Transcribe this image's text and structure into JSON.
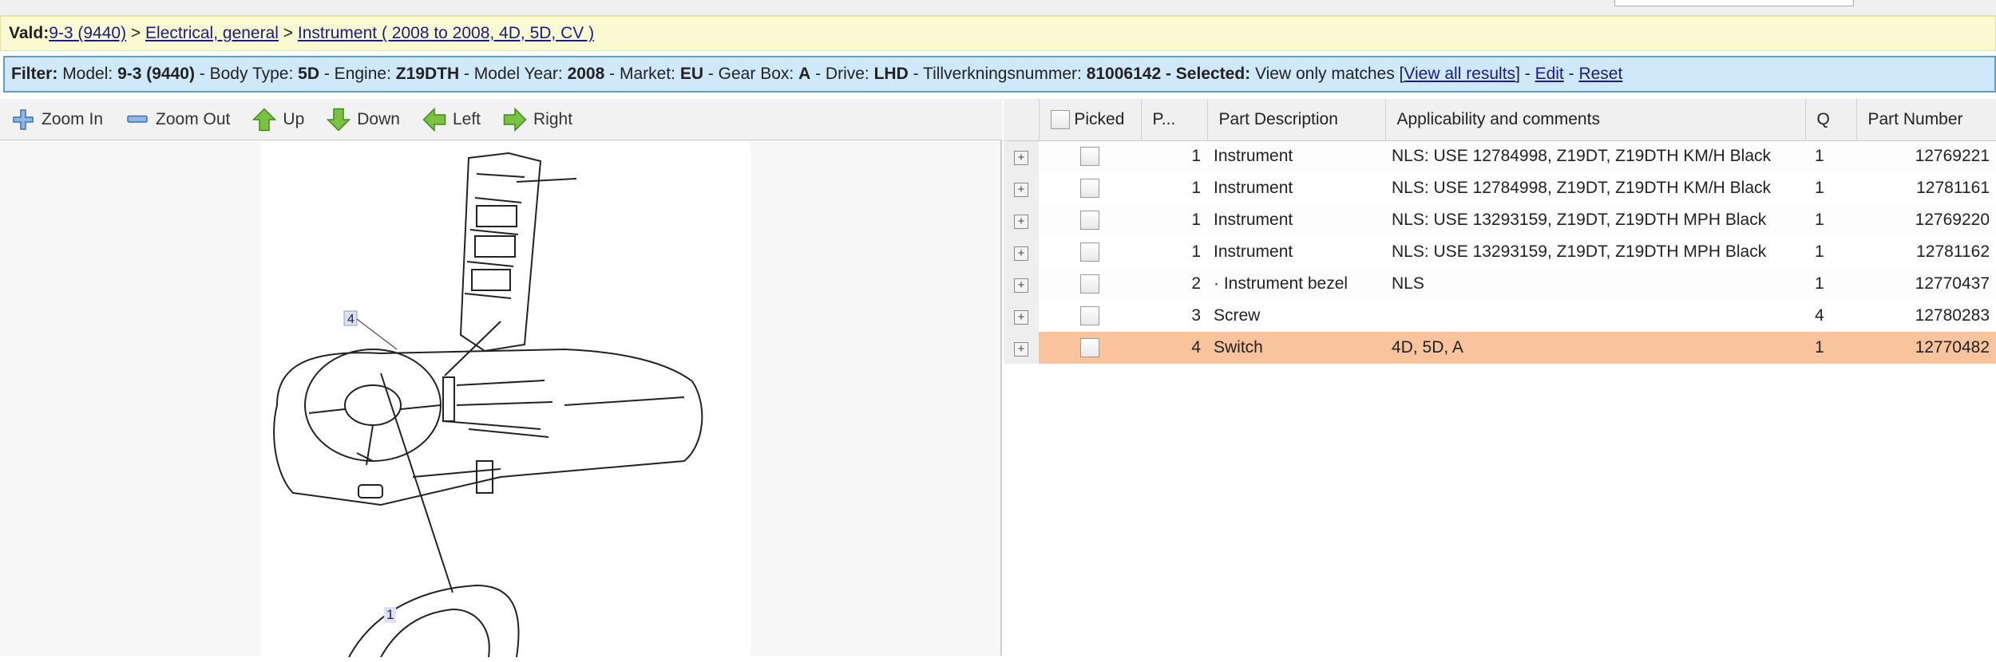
{
  "breadcrumb": {
    "prefix": "Vald:",
    "model": "9-3 (9440)",
    "sep": ">",
    "group": "Electrical, general",
    "item": "Instrument ( 2008 to 2008, 4D, 5D, CV )"
  },
  "filter": {
    "label": "Filter:",
    "model_l": "Model:",
    "model": "9-3 (9440)",
    "body_l": "- Body Type:",
    "body": "5D",
    "engine_l": "- Engine:",
    "engine": "Z19DTH",
    "year_l": "- Model Year:",
    "year": "2008",
    "market_l": "- Market:",
    "market": "EU",
    "gear_l": "- Gear Box:",
    "gear": "A",
    "drive_l": "- Drive:",
    "drive": "LHD",
    "tillv_l": "- Tillverkningsnummer:",
    "tillv": "81006142",
    "selected_l": "- Selected:",
    "selected": "View only matches [",
    "view_all": "View all results",
    "sep1": "] -",
    "edit": "Edit",
    "sep2": "-",
    "reset": "Reset"
  },
  "toolbar": {
    "zoom_in": "Zoom In",
    "zoom_out": "Zoom Out",
    "up": "Up",
    "down": "Down",
    "left": "Left",
    "right": "Right"
  },
  "diagram": {
    "callouts": [
      "4",
      "1"
    ]
  },
  "table": {
    "headers": {
      "picked": "Picked",
      "pos": "P...",
      "desc": "Part Description",
      "appl": "Applicability and comments",
      "qty": "Q",
      "partno": "Part Number"
    },
    "rows": [
      {
        "pos": "1",
        "desc": "Instrument",
        "appl": "NLS: USE 12784998, Z19DT, Z19DTH KM/H Black",
        "qty": "1",
        "partno": "12769221"
      },
      {
        "pos": "1",
        "desc": "Instrument",
        "appl": "NLS: USE 12784998, Z19DT, Z19DTH KM/H Black",
        "qty": "1",
        "partno": "12781161"
      },
      {
        "pos": "1",
        "desc": "Instrument",
        "appl": "NLS: USE 13293159, Z19DT, Z19DTH MPH Black",
        "qty": "1",
        "partno": "12769220"
      },
      {
        "pos": "1",
        "desc": "Instrument",
        "appl": "NLS: USE 13293159, Z19DT, Z19DTH MPH Black",
        "qty": "1",
        "partno": "12781162"
      },
      {
        "pos": "2",
        "desc": "· Instrument bezel",
        "appl": "NLS",
        "qty": "1",
        "partno": "12770437"
      },
      {
        "pos": "3",
        "desc": "Screw",
        "appl": "",
        "qty": "4",
        "partno": "12780283"
      },
      {
        "pos": "4",
        "desc": "Switch",
        "appl": "4D, 5D, A",
        "qty": "1",
        "partno": "12770482"
      }
    ],
    "selected_row_color": "#f9c49d"
  }
}
